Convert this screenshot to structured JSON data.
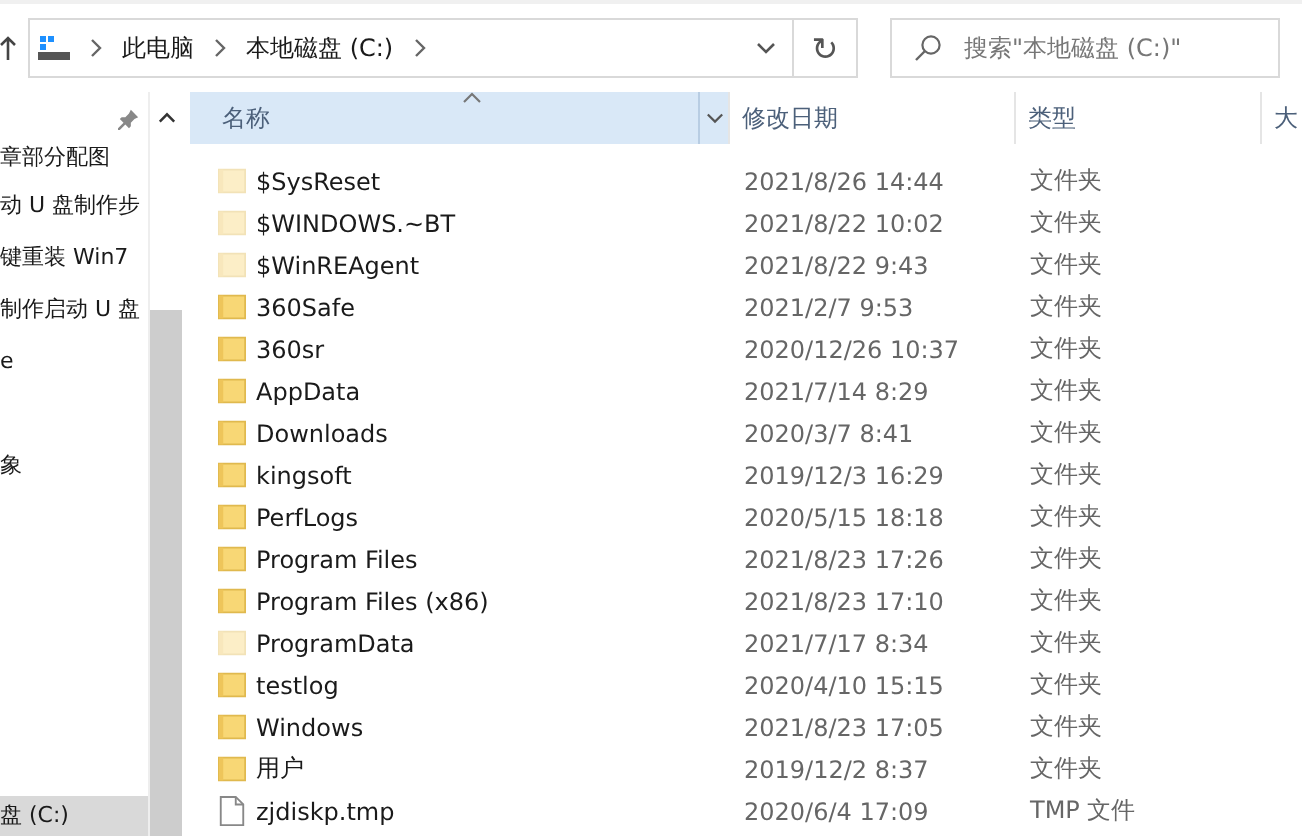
{
  "address_bar": {
    "crumbs": [
      "此电脑",
      "本地磁盘 (C:)"
    ]
  },
  "refresh_button": {
    "label": "↻"
  },
  "search": {
    "placeholder": "搜索\"本地磁盘 (C:)\""
  },
  "nav_pane": {
    "items": [
      {
        "label": "章部分配图",
        "selected": false
      },
      {
        "label": "动 U 盘制作步",
        "selected": false
      },
      {
        "label": "键重装 Win7",
        "selected": false
      },
      {
        "label": "制作启动 U 盘",
        "selected": false
      },
      {
        "label": "e",
        "selected": false
      },
      {
        "label": "象",
        "selected": false
      },
      {
        "label": "盘 (C:)",
        "selected": true
      }
    ]
  },
  "table": {
    "columns": [
      {
        "label": "名称",
        "sorted": true
      },
      {
        "label": "修改日期",
        "sorted": false
      },
      {
        "label": "类型",
        "sorted": false
      },
      {
        "label": "大",
        "sorted": false
      }
    ],
    "rows": [
      {
        "kind": "folder",
        "hidden": true,
        "name": "$SysReset",
        "modified": "2021/8/26 14:44",
        "type": "文件夹"
      },
      {
        "kind": "folder",
        "hidden": true,
        "name": "$WINDOWS.~BT",
        "modified": "2021/8/22 10:02",
        "type": "文件夹"
      },
      {
        "kind": "folder",
        "hidden": true,
        "name": "$WinREAgent",
        "modified": "2021/8/22 9:43",
        "type": "文件夹"
      },
      {
        "kind": "folder",
        "hidden": false,
        "name": "360Safe",
        "modified": "2021/2/7 9:53",
        "type": "文件夹"
      },
      {
        "kind": "folder",
        "hidden": false,
        "name": "360sr",
        "modified": "2020/12/26 10:37",
        "type": "文件夹"
      },
      {
        "kind": "folder",
        "hidden": false,
        "name": "AppData",
        "modified": "2021/7/14 8:29",
        "type": "文件夹"
      },
      {
        "kind": "folder",
        "hidden": false,
        "name": "Downloads",
        "modified": "2020/3/7 8:41",
        "type": "文件夹"
      },
      {
        "kind": "folder",
        "hidden": false,
        "name": "kingsoft",
        "modified": "2019/12/3 16:29",
        "type": "文件夹"
      },
      {
        "kind": "folder",
        "hidden": false,
        "name": "PerfLogs",
        "modified": "2020/5/15 18:18",
        "type": "文件夹"
      },
      {
        "kind": "folder",
        "hidden": false,
        "name": "Program Files",
        "modified": "2021/8/23 17:26",
        "type": "文件夹"
      },
      {
        "kind": "folder",
        "hidden": false,
        "name": "Program Files (x86)",
        "modified": "2021/8/23 17:10",
        "type": "文件夹"
      },
      {
        "kind": "folder",
        "hidden": true,
        "name": "ProgramData",
        "modified": "2021/7/17 8:34",
        "type": "文件夹"
      },
      {
        "kind": "folder",
        "hidden": false,
        "name": "testlog",
        "modified": "2020/4/10 15:15",
        "type": "文件夹"
      },
      {
        "kind": "folder",
        "hidden": false,
        "name": "Windows",
        "modified": "2021/8/23 17:05",
        "type": "文件夹"
      },
      {
        "kind": "folder",
        "hidden": false,
        "name": "用户",
        "modified": "2019/12/2 8:37",
        "type": "文件夹"
      },
      {
        "kind": "file",
        "hidden": false,
        "name": "zjdiskp.tmp",
        "modified": "2020/6/4 17:09",
        "type": "TMP 文件"
      }
    ]
  }
}
